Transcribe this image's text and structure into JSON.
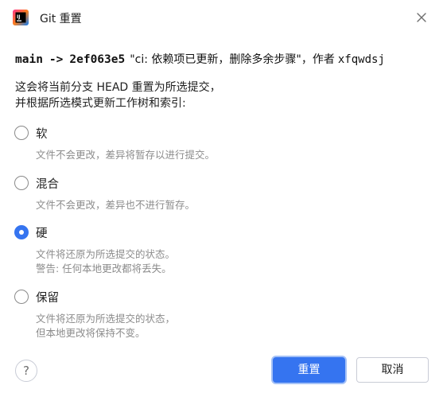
{
  "window": {
    "title": "Git 重置"
  },
  "header": {
    "branch": "main",
    "arrow": "->",
    "commit_hash": "2ef063e5",
    "commit_message": "\"ci: 依赖项已更新，删除多余步骤\"，作者",
    "author": "xfqwdsj"
  },
  "description": {
    "line1": "这会将当前分支 HEAD 重置为所选提交，",
    "line2": "并根据所选模式更新工作树和索引:"
  },
  "options": [
    {
      "label": "软",
      "hint_lines": [
        "文件不会更改，差异将暂存以进行提交。"
      ],
      "checked": false
    },
    {
      "label": "混合",
      "hint_lines": [
        "文件不会更改，差异也不进行暂存。"
      ],
      "checked": false
    },
    {
      "label": "硬",
      "hint_lines": [
        "文件将还原为所选提交的状态。",
        "警告: 任何本地更改都将丢失。"
      ],
      "checked": true
    },
    {
      "label": "保留",
      "hint_lines": [
        "文件将还原为所选提交的状态，",
        "但本地更改将保持不变。"
      ],
      "checked": false
    }
  ],
  "footer": {
    "help_label": "?",
    "reset_label": "重置",
    "cancel_label": "取消"
  },
  "colors": {
    "accent": "#3574f0",
    "hint": "#8c8c8c"
  },
  "icons": {
    "app": "intellij-idea-icon",
    "close": "close-icon"
  }
}
